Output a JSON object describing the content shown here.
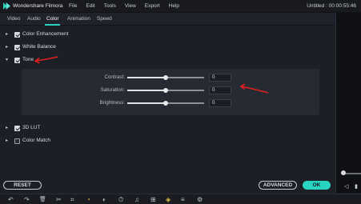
{
  "app": {
    "name": "Wondershare Filmora",
    "menu": [
      "File",
      "Edit",
      "Tools",
      "View",
      "Export",
      "Help"
    ],
    "project_title": "Untitled : 00:00:55:46"
  },
  "tabs": [
    "Video",
    "Audio",
    "Color",
    "Animation",
    "Speed"
  ],
  "active_tab": "Color",
  "sections": [
    {
      "label": "Color Enhancement",
      "checked": true,
      "expanded": false
    },
    {
      "label": "White Balance",
      "checked": true,
      "expanded": false
    },
    {
      "label": "Tone",
      "checked": true,
      "expanded": true
    },
    {
      "label": "3D LUT",
      "checked": true,
      "expanded": false
    },
    {
      "label": "Color Match",
      "checked": false,
      "expanded": false
    }
  ],
  "tone": {
    "contrast": {
      "label": "Contrast:",
      "value": "0"
    },
    "saturation": {
      "label": "Saturation:",
      "value": "0"
    },
    "brightness": {
      "label": "Brightness:",
      "value": "0"
    }
  },
  "buttons": {
    "reset": "RESET",
    "advanced": "ADVANCED",
    "ok": "OK"
  },
  "colors": {
    "accent": "#2ad3c0",
    "annotation": "#e02020"
  },
  "icons": {
    "chevron_collapsed": "▸",
    "chevron_expanded": "▾",
    "undo": "↶",
    "redo": "↷",
    "delete": "🗑",
    "cut": "✂",
    "crop": "⌗",
    "speed": "◔",
    "color": "◐",
    "timer": "⏱",
    "audio": "♫",
    "split": "⊞",
    "green_screen": "◈",
    "audio_mixer": "≡",
    "adjust": "⚙"
  },
  "playback": {
    "prev_frame": "◁",
    "play": "▮"
  }
}
